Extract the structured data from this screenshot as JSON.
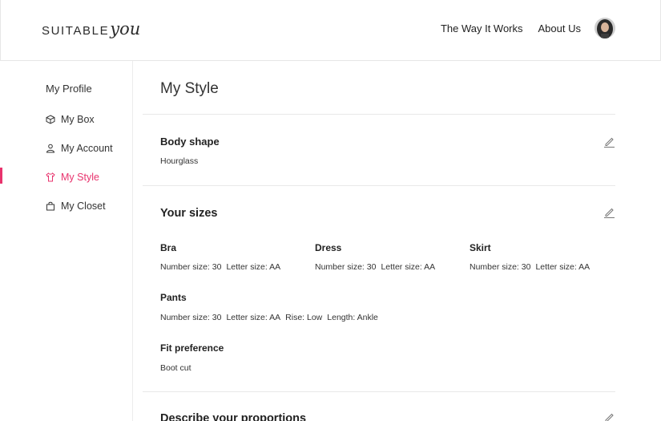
{
  "header": {
    "logo_text": "SUITABLE",
    "logo_script": "you",
    "nav": [
      "The Way It Works",
      "About Us"
    ]
  },
  "sidebar": {
    "title": "My Profile",
    "items": [
      {
        "label": "My Box",
        "icon": "box-icon"
      },
      {
        "label": "My Account",
        "icon": "user-icon"
      },
      {
        "label": "My Style",
        "icon": "shirt-icon",
        "active": true
      },
      {
        "label": "My Closet",
        "icon": "bag-icon"
      }
    ],
    "active_color": "#e8336d"
  },
  "main": {
    "title": "My Style",
    "body_shape": {
      "title": "Body shape",
      "value": "Hourglass"
    },
    "sizes": {
      "title": "Your sizes",
      "bra": {
        "label": "Bra",
        "number": "Number size: 30",
        "letter": "Letter size: AA"
      },
      "dress": {
        "label": "Dress",
        "number": "Number size: 30",
        "letter": "Letter size: AA"
      },
      "skirt": {
        "label": "Skirt",
        "number": "Number size: 30",
        "letter": "Letter size: AA"
      },
      "pants": {
        "label": "Pants",
        "number": "Number size: 30",
        "letter": "Letter size: AA",
        "rise": "Rise: Low",
        "length": "Length: Ankle"
      },
      "fit": {
        "label": "Fit preference",
        "value": "Boot cut"
      }
    },
    "proportions": {
      "title": "Describe your proportions"
    }
  }
}
